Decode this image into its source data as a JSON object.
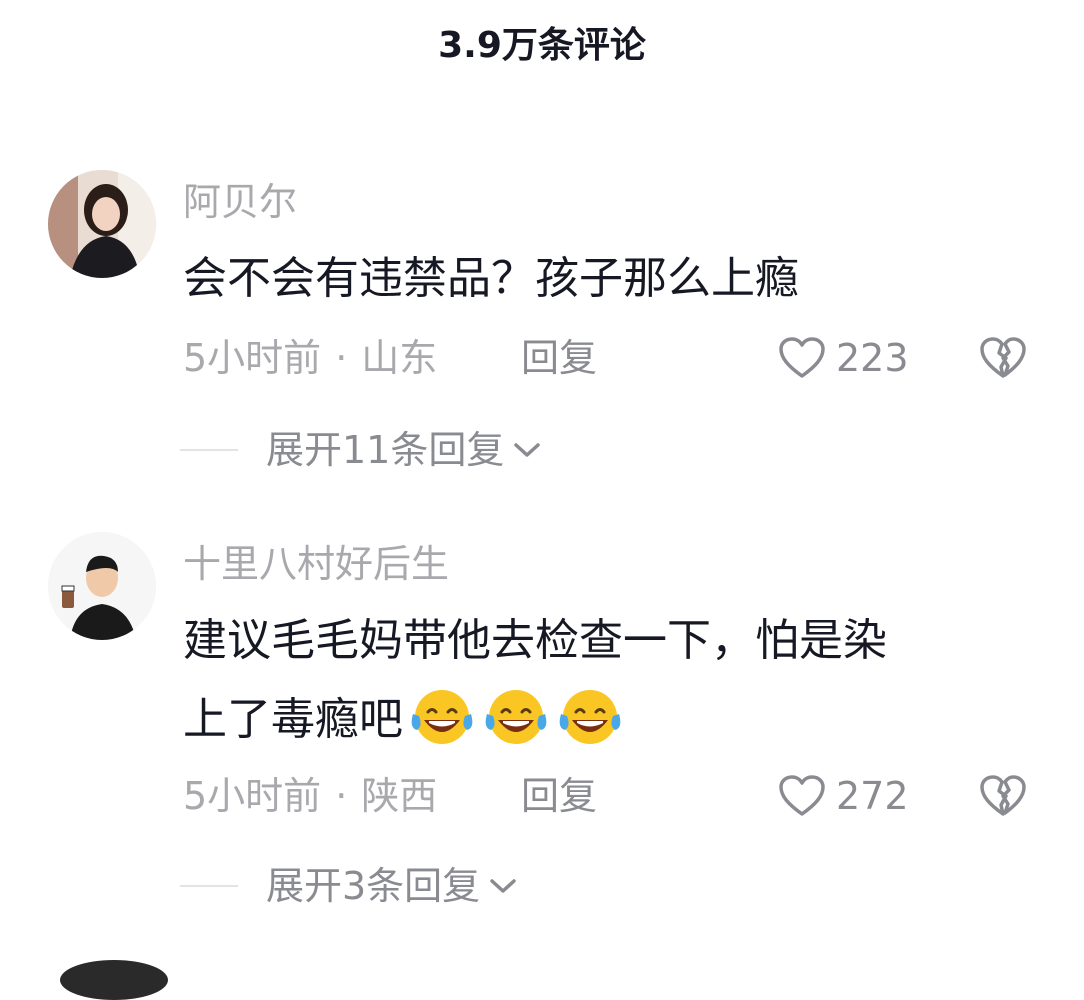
{
  "header": {
    "title": "3.9万条评论"
  },
  "comments": [
    {
      "username": "阿贝尔",
      "content": "会不会有违禁品？孩子那么上瘾",
      "time": "5小时前",
      "location": "山东",
      "separator": "·",
      "reply_label": "回复",
      "likes": "223",
      "expand_label": "展开11条回复"
    },
    {
      "username": "十里八村好后生",
      "content_line1": "建议毛毛妈带他去检查一下，怕是染",
      "content_line2": "上了毒瘾吧",
      "emoji_icons": [
        "tears-of-joy-emoji",
        "tears-of-joy-emoji",
        "tears-of-joy-emoji"
      ],
      "time": "5小时前",
      "location": "陕西",
      "separator": "·",
      "reply_label": "回复",
      "likes": "272",
      "expand_label": "展开3条回复"
    }
  ],
  "colors": {
    "text_primary": "#161823",
    "text_secondary": "#a8a8ad",
    "text_action": "#8a8b91",
    "divider": "#e3e3e6"
  }
}
